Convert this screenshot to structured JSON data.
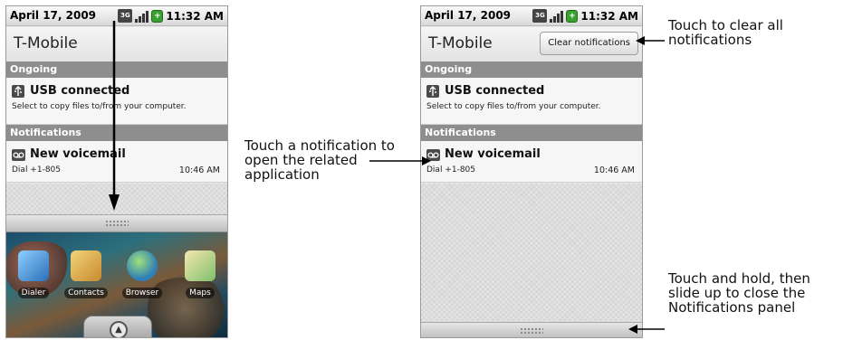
{
  "status_bar": {
    "date": "April 17, 2009",
    "time": "11:32 AM",
    "network_badge": "3G"
  },
  "header": {
    "carrier": "T-Mobile",
    "clear_button": "Clear notifications"
  },
  "sections": {
    "ongoing": "Ongoing",
    "notifications": "Notifications"
  },
  "ongoing_item": {
    "title": "USB connected",
    "description": "Select to copy files to/from your computer.",
    "icon": "usb-icon"
  },
  "notification_item": {
    "title": "New voicemail",
    "description": "Dial +1-805",
    "time": "10:46 AM",
    "icon": "voicemail-icon"
  },
  "home_apps": [
    "Dialer",
    "Contacts",
    "Browser",
    "Maps"
  ],
  "callouts": {
    "open": "Touch a notification to open the related application",
    "clear": "Touch to clear all notifications",
    "close": "Touch and hold, then slide up to close the Notifications panel"
  },
  "colors": {
    "section_header": "#8e8e8e",
    "battery": "#3aa130",
    "panel_bg": "#e9e9e9"
  }
}
